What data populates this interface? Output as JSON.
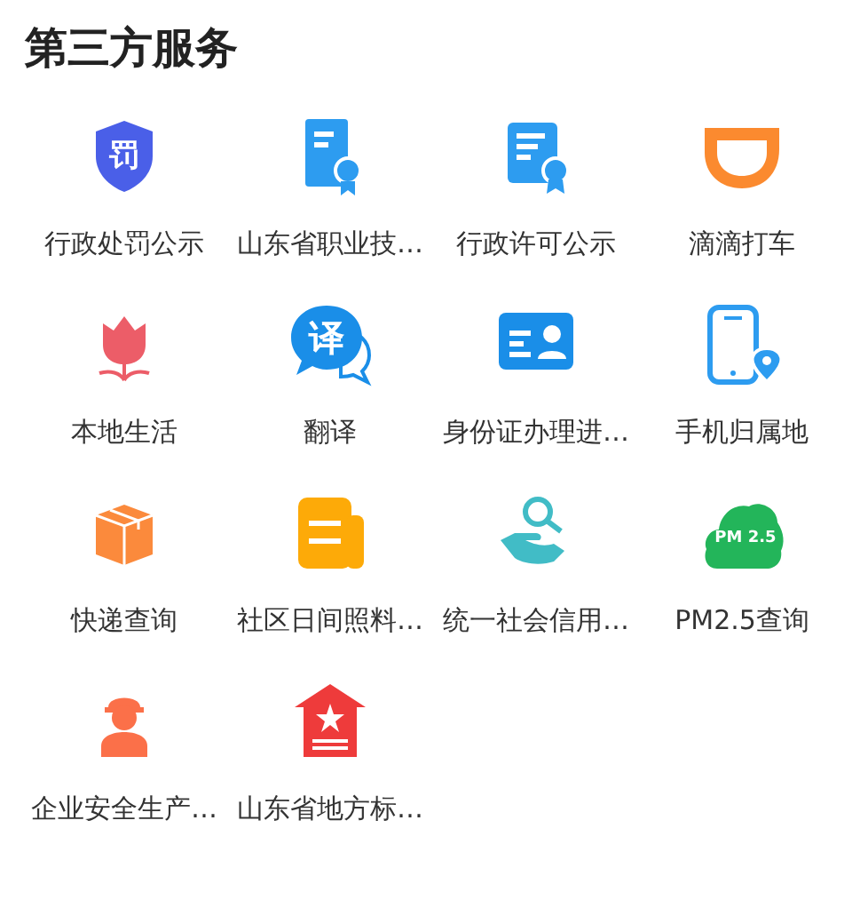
{
  "section_title": "第三方服务",
  "services": [
    {
      "label": "行政处罚公示",
      "kind": "shield",
      "icon_text": "罚"
    },
    {
      "label": "山东省职业技…",
      "kind": "certificate"
    },
    {
      "label": "行政许可公示",
      "kind": "license"
    },
    {
      "label": "滴滴打车",
      "kind": "cup"
    },
    {
      "label": "本地生活",
      "kind": "tulip"
    },
    {
      "label": "翻译",
      "kind": "bubble",
      "icon_text": "译"
    },
    {
      "label": "身份证办理进…",
      "kind": "idcard"
    },
    {
      "label": "手机归属地",
      "kind": "phone"
    },
    {
      "label": "快递查询",
      "kind": "package"
    },
    {
      "label": "社区日间照料…",
      "kind": "document"
    },
    {
      "label": "统一社会信用…",
      "kind": "hand"
    },
    {
      "label": "PM2.5查询",
      "kind": "cloud",
      "icon_text": "PM 2.5"
    },
    {
      "label": "企业安全生产…",
      "kind": "worker"
    },
    {
      "label": "山东省地方标…",
      "kind": "house"
    }
  ]
}
